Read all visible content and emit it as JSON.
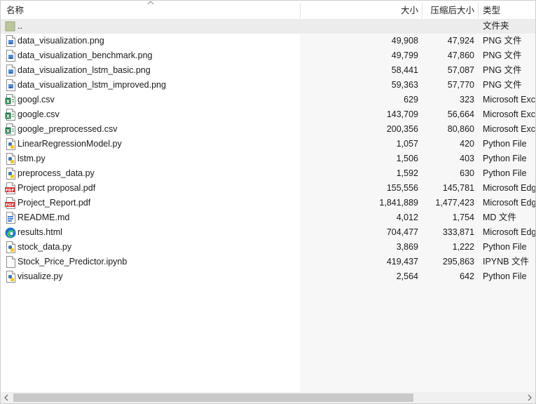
{
  "columns": {
    "name": "名称",
    "size": "大小",
    "packed": "压缩后大小",
    "type": "类型"
  },
  "rows": [
    {
      "icon": "folder-up-icon",
      "name": "..",
      "size": "",
      "packed": "",
      "type": "文件夹"
    },
    {
      "icon": "png-file-icon",
      "name": "data_visualization.png",
      "size": "49,908",
      "packed": "47,924",
      "type": "PNG 文件"
    },
    {
      "icon": "png-file-icon",
      "name": "data_visualization_benchmark.png",
      "size": "49,799",
      "packed": "47,860",
      "type": "PNG 文件"
    },
    {
      "icon": "png-file-icon",
      "name": "data_visualization_lstm_basic.png",
      "size": "58,441",
      "packed": "57,087",
      "type": "PNG 文件"
    },
    {
      "icon": "png-file-icon",
      "name": "data_visualization_lstm_improved.png",
      "size": "59,363",
      "packed": "57,770",
      "type": "PNG 文件"
    },
    {
      "icon": "excel-file-icon",
      "name": "googl.csv",
      "size": "629",
      "packed": "323",
      "type": "Microsoft Excel"
    },
    {
      "icon": "excel-file-icon",
      "name": "google.csv",
      "size": "143,709",
      "packed": "56,664",
      "type": "Microsoft Excel"
    },
    {
      "icon": "excel-file-icon",
      "name": "google_preprocessed.csv",
      "size": "200,356",
      "packed": "80,860",
      "type": "Microsoft Excel"
    },
    {
      "icon": "python-file-icon",
      "name": "LinearRegressionModel.py",
      "size": "1,057",
      "packed": "420",
      "type": "Python File"
    },
    {
      "icon": "python-file-icon",
      "name": "lstm.py",
      "size": "1,506",
      "packed": "403",
      "type": "Python File"
    },
    {
      "icon": "python-file-icon",
      "name": "preprocess_data.py",
      "size": "1,592",
      "packed": "630",
      "type": "Python File"
    },
    {
      "icon": "pdf-file-icon",
      "name": "Project proposal.pdf",
      "size": "155,556",
      "packed": "145,781",
      "type": "Microsoft Edge"
    },
    {
      "icon": "pdf-file-icon",
      "name": "Project_Report.pdf",
      "size": "1,841,889",
      "packed": "1,477,423",
      "type": "Microsoft Edge"
    },
    {
      "icon": "markdown-file-icon",
      "name": "README.md",
      "size": "4,012",
      "packed": "1,754",
      "type": "MD 文件"
    },
    {
      "icon": "edge-html-file-icon",
      "name": "results.html",
      "size": "704,477",
      "packed": "333,871",
      "type": "Microsoft Edge"
    },
    {
      "icon": "python-file-icon",
      "name": "stock_data.py",
      "size": "3,869",
      "packed": "1,222",
      "type": "Python File"
    },
    {
      "icon": "blank-file-icon",
      "name": "Stock_Price_Predictor.ipynb",
      "size": "419,437",
      "packed": "295,863",
      "type": "IPYNB 文件"
    },
    {
      "icon": "python-file-icon",
      "name": "visualize.py",
      "size": "2,564",
      "packed": "642",
      "type": "Python File"
    }
  ],
  "colors": {
    "excel": "#1f7a45",
    "pdf": "#d32f2f",
    "python_blue": "#3f74b5",
    "python_yellow": "#f5c518",
    "edge_blue": "#1b6fd1",
    "edge_green": "#3ec46d",
    "folder": "#b9c79a",
    "selected_row": "#ececec"
  }
}
